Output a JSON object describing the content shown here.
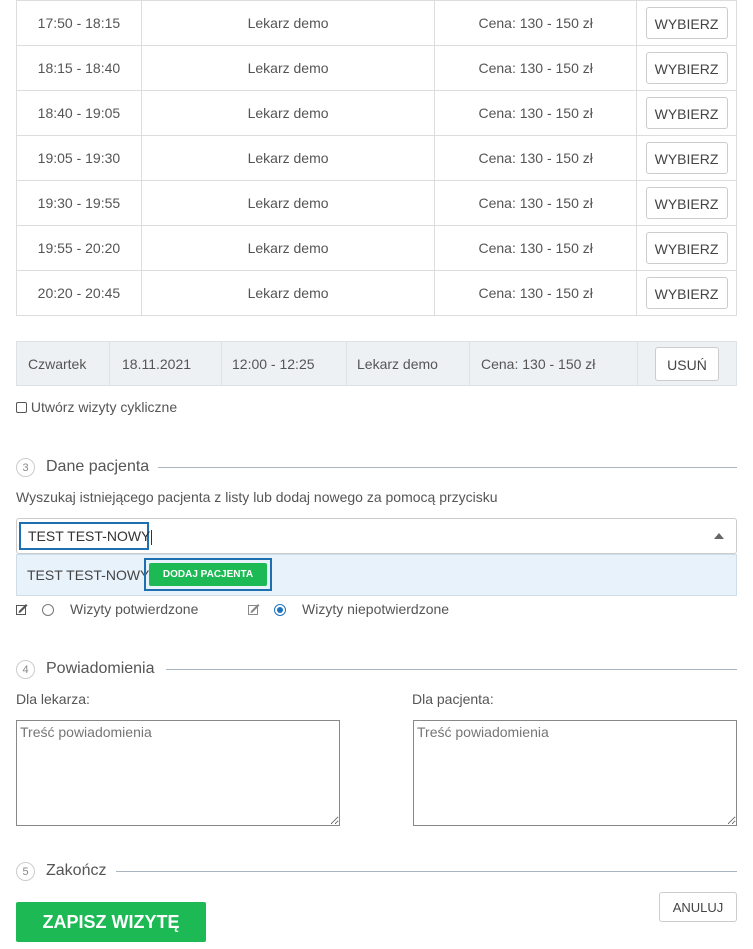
{
  "slots": [
    {
      "time": "17:50 - 18:15",
      "doctor": "Lekarz demo",
      "price": "Cena: 130 - 150 zł",
      "button": "WYBIERZ"
    },
    {
      "time": "18:15 - 18:40",
      "doctor": "Lekarz demo",
      "price": "Cena: 130 - 150 zł",
      "button": "WYBIERZ"
    },
    {
      "time": "18:40 - 19:05",
      "doctor": "Lekarz demo",
      "price": "Cena: 130 - 150 zł",
      "button": "WYBIERZ"
    },
    {
      "time": "19:05 - 19:30",
      "doctor": "Lekarz demo",
      "price": "Cena: 130 - 150 zł",
      "button": "WYBIERZ"
    },
    {
      "time": "19:30 - 19:55",
      "doctor": "Lekarz demo",
      "price": "Cena: 130 - 150 zł",
      "button": "WYBIERZ"
    },
    {
      "time": "19:55 - 20:20",
      "doctor": "Lekarz demo",
      "price": "Cena: 130 - 150 zł",
      "button": "WYBIERZ"
    },
    {
      "time": "20:20 - 20:45",
      "doctor": "Lekarz demo",
      "price": "Cena: 130 - 150 zł",
      "button": "WYBIERZ"
    }
  ],
  "selected": {
    "day": "Czwartek",
    "date": "18.11.2021",
    "time": "12:00 - 12:25",
    "doctor": "Lekarz demo",
    "price": "Cena: 130 - 150 zł",
    "remove_label": "USUŃ"
  },
  "cyclic_label": "Utwórz wizyty cykliczne",
  "patient": {
    "num": "3",
    "title": "Dane pacjenta",
    "hint": "Wyszukaj istniejącego pacjenta z listy lub dodaj nowego za pomocą przycisku",
    "search_value": "TEST TEST-NOWY",
    "option_label": "TEST TEST-NOWY",
    "add_button": "DODAJ PACJENTA",
    "confirmed_label": "Wizyty potwierdzone",
    "unconfirmed_label": "Wizyty niepotwierdzone"
  },
  "notifications": {
    "num": "4",
    "title": "Powiadomienia",
    "doctor_label": "Dla lekarza:",
    "patient_label": "Dla pacjenta:",
    "placeholder": "Treść powiadomienia"
  },
  "finish": {
    "num": "5",
    "title": "Zakończ",
    "save_label": "ZAPISZ WIZYTĘ",
    "cancel_label": "ANULUJ"
  },
  "colors": {
    "accent_green": "#1db954",
    "focus_blue": "#1e6fb0",
    "dropdown_bg": "#e8f2fb"
  }
}
